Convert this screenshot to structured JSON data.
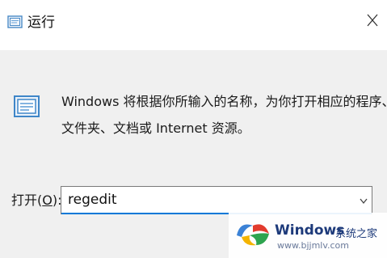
{
  "window": {
    "title": "运行",
    "title_icon": "run-app-icon",
    "close_icon": "close-icon"
  },
  "description": {
    "line1": "Windows 将根据你所输入的名称，为你打开相应的程序、",
    "line2": "文件夹、文档或 Internet 资源。"
  },
  "open_field": {
    "label_prefix": "打开(",
    "label_hotkey": "O",
    "label_suffix": "):",
    "value": "regedit",
    "dropdown_icon": "chevron-down-icon"
  },
  "watermark": {
    "title": "Windows",
    "subtitle": "系统之家",
    "url": "www.bjjmlv.com"
  },
  "colors": {
    "titlebar_bg": "#ffffff",
    "content_bg": "#f0f0f0",
    "focus_accent": "#0078d7",
    "watermark_text": "#1d3a7a"
  }
}
